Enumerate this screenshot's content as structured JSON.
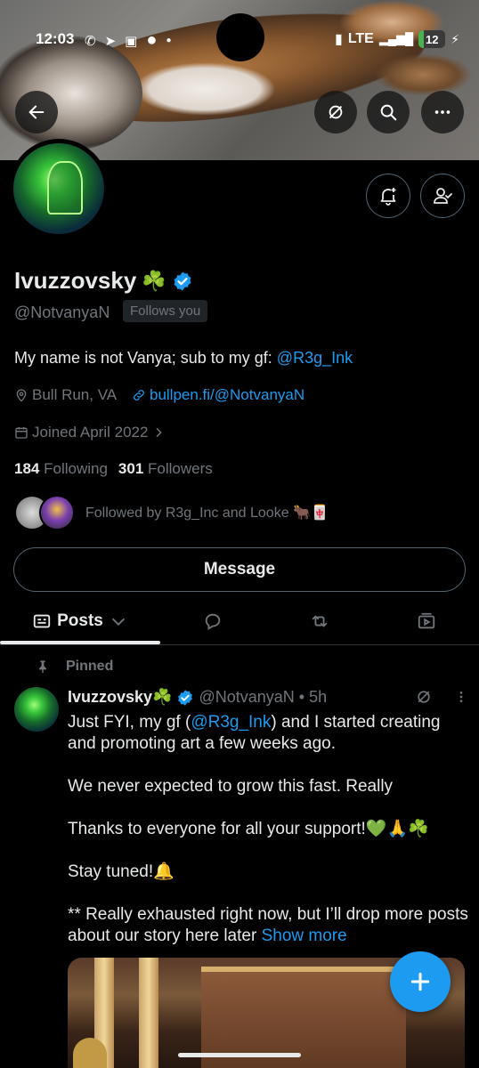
{
  "status_bar": {
    "time": "12:03",
    "network": "LTE",
    "battery": "12"
  },
  "profile": {
    "name": "Ivuzzovsky",
    "name_emoji": "☘️",
    "handle": "@NotvanyaN",
    "follows_you": "Follows you",
    "bio_text": "My name is not Vanya; sub to my gf: ",
    "bio_mention": "@R3g_Ink",
    "location": "Bull Run, VA",
    "website": "bullpen.fi/@NotvanyaN",
    "joined": "Joined April 2022",
    "following_count": "184",
    "following_label": "Following",
    "followers_count": "301",
    "followers_label": "Followers",
    "followed_by": "Followed by R3g_Inc and Looke 🐂🀄"
  },
  "buttons": {
    "message": "Message"
  },
  "tabs": {
    "posts": "Posts"
  },
  "post": {
    "pinned_label": "Pinned",
    "author_name": "Ivuzzovsky☘️",
    "author_handle": "@NotvanyaN",
    "time": "• 5h",
    "line1_a": "Just FYI, my gf (",
    "line1_mention": "@R3g_Ink",
    "line1_b": ") and I started creating and promoting art a few weeks ago.",
    "para2": "We never expected to grow this fast. Really",
    "para3": "Thanks to everyone for all your support!💚🙏☘️",
    "para4": "Stay tuned!🔔",
    "para5": "** Really exhausted right now, but I’ll drop more posts about our story here later ",
    "show_more": "Show more"
  },
  "colors": {
    "accent": "#1d9bf0",
    "muted": "#71767b",
    "text": "#e7e9ea",
    "background": "#000000"
  },
  "icons": [
    "back-arrow-icon",
    "grok-icon",
    "search-icon",
    "more-icon",
    "notification-bell-icon",
    "following-icon",
    "location-icon",
    "link-icon",
    "calendar-icon",
    "chevron-right-icon",
    "replies-icon",
    "retweet-icon",
    "media-icon",
    "pin-icon",
    "verified-badge-icon",
    "compose-plus-icon"
  ]
}
